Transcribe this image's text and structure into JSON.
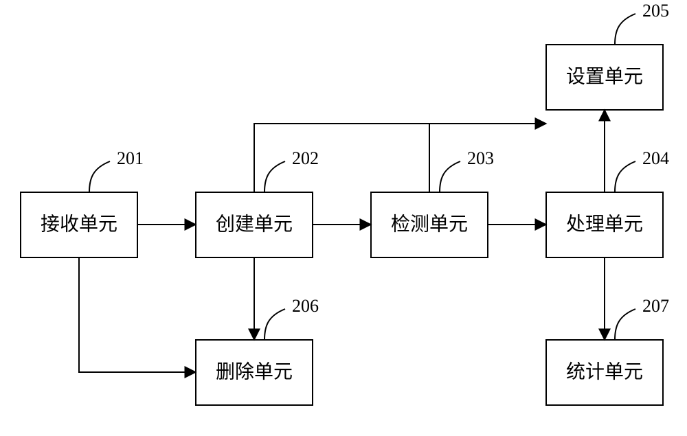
{
  "nodes": {
    "n201": {
      "num": "201",
      "label": "接收单元"
    },
    "n202": {
      "num": "202",
      "label": "创建单元"
    },
    "n203": {
      "num": "203",
      "label": "检测单元"
    },
    "n204": {
      "num": "204",
      "label": "处理单元"
    },
    "n205": {
      "num": "205",
      "label": "设置单元"
    },
    "n206": {
      "num": "206",
      "label": "删除单元"
    },
    "n207": {
      "num": "207",
      "label": "统计单元"
    }
  }
}
